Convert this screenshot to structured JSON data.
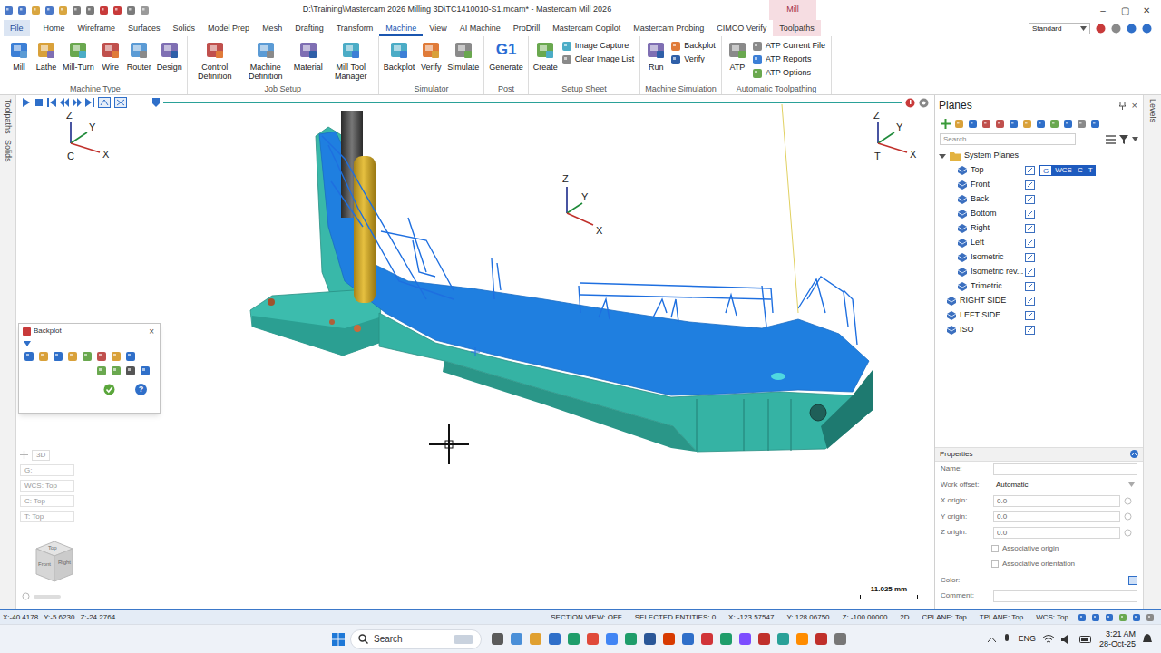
{
  "window": {
    "title": "D:\\Training\\Mastercam 2026 Milling 3D\\TC1410010-S1.mcam* - Mastercam Mill 2026",
    "context_label": "Mill",
    "controls": [
      "–",
      "▢",
      "✕"
    ]
  },
  "ribbon": {
    "tabs": [
      {
        "label": "File",
        "kind": "file",
        "selected": false
      },
      {
        "label": "Home",
        "kind": "tab",
        "selected": false
      },
      {
        "label": "Wireframe",
        "kind": "tab",
        "selected": false
      },
      {
        "label": "Surfaces",
        "kind": "tab",
        "selected": false
      },
      {
        "label": "Solids",
        "kind": "tab",
        "selected": false
      },
      {
        "label": "Model Prep",
        "kind": "tab",
        "selected": false
      },
      {
        "label": "Mesh",
        "kind": "tab",
        "selected": false
      },
      {
        "label": "Drafting",
        "kind": "tab",
        "selected": false
      },
      {
        "label": "Transform",
        "kind": "tab",
        "selected": false
      },
      {
        "label": "Machine",
        "kind": "tab",
        "selected": true
      },
      {
        "label": "View",
        "kind": "tab",
        "selected": false
      },
      {
        "label": "AI Machine",
        "kind": "tab",
        "selected": false
      },
      {
        "label": "ProDrill",
        "kind": "tab",
        "selected": false
      },
      {
        "label": "Mastercam Copilot",
        "kind": "tab",
        "selected": false
      },
      {
        "label": "Mastercam Probing",
        "kind": "tab",
        "selected": false
      },
      {
        "label": "CIMCO Verify",
        "kind": "tab",
        "selected": false
      },
      {
        "label": "Toolpaths",
        "kind": "context",
        "selected": false
      }
    ],
    "workspace": "Standard",
    "groups": [
      {
        "label": "Machine Type",
        "items": [
          {
            "label": "Mill",
            "kind": "large"
          },
          {
            "label": "Lathe",
            "kind": "large"
          },
          {
            "label": "Mill-Turn",
            "kind": "large"
          },
          {
            "label": "Wire",
            "kind": "large"
          },
          {
            "label": "Router",
            "kind": "large"
          },
          {
            "label": "Design",
            "kind": "large"
          }
        ]
      },
      {
        "label": "Job Setup",
        "items": [
          {
            "label": "Control Definition",
            "kind": "large"
          },
          {
            "label": "Machine Definition",
            "kind": "large"
          },
          {
            "label": "Material",
            "kind": "large"
          },
          {
            "label": "Mill Tool Manager",
            "kind": "large"
          }
        ]
      },
      {
        "label": "Simulator",
        "items": [
          {
            "label": "Backplot",
            "kind": "large"
          },
          {
            "label": "Verify",
            "kind": "large"
          },
          {
            "label": "Simulate",
            "kind": "large"
          }
        ]
      },
      {
        "label": "Post",
        "items": [
          {
            "label": "Generate",
            "kind": "large",
            "glyph": "G1"
          }
        ]
      },
      {
        "label": "Setup Sheet",
        "items": [
          {
            "label": "Create",
            "kind": "large"
          },
          {
            "label": "Image Capture",
            "kind": "small"
          },
          {
            "label": "Clear Image List",
            "kind": "small"
          }
        ]
      },
      {
        "label": "Machine Simulation",
        "items": [
          {
            "label": "Run",
            "kind": "large"
          },
          {
            "label": "Backplot",
            "kind": "small"
          },
          {
            "label": "Verify",
            "kind": "small"
          }
        ]
      },
      {
        "label": "Automatic Toolpathing",
        "items": [
          {
            "label": "ATP",
            "kind": "large"
          },
          {
            "label": "ATP Current File",
            "kind": "small"
          },
          {
            "label": "ATP Reports",
            "kind": "small"
          },
          {
            "label": "ATP Options",
            "kind": "small"
          }
        ]
      }
    ]
  },
  "playback": {
    "level": 1
  },
  "side_tabs": {
    "left": [
      "Toolpaths",
      "Solids"
    ],
    "right": [
      "Levels"
    ]
  },
  "viewport": {
    "gizmo_left": {
      "axes": {
        "z": "Z",
        "y": "Y",
        "x": "X"
      },
      "label": "C"
    },
    "gizmo_center": {
      "axes": {
        "z": "Z",
        "y": "Y",
        "x": "X"
      }
    },
    "gizmo_right": {
      "axes": {
        "z": "Z",
        "y": "Y",
        "x": "X"
      },
      "label": "T"
    },
    "scale": "11.025 mm"
  },
  "backplot": {
    "title": "Backplot",
    "close": "×",
    "help": "?"
  },
  "view_info": {
    "mode": "3D",
    "rows": [
      "G:",
      "WCS: Top",
      "C: Top",
      "T: Top"
    ],
    "cube_faces": [
      "Top",
      "Front",
      "Right"
    ]
  },
  "planes": {
    "title": "Planes",
    "close": "×",
    "search": {
      "placeholder": "Search"
    },
    "tree": [
      {
        "label": "System Planes",
        "kind": "folder",
        "expanded": true
      },
      {
        "label": "Top",
        "kind": "plane",
        "badges": [
          "G",
          "WCS",
          "C",
          "T"
        ]
      },
      {
        "label": "Front",
        "kind": "plane"
      },
      {
        "label": "Back",
        "kind": "plane"
      },
      {
        "label": "Bottom",
        "kind": "plane"
      },
      {
        "label": "Right",
        "kind": "plane"
      },
      {
        "label": "Left",
        "kind": "plane"
      },
      {
        "label": "Isometric",
        "kind": "plane"
      },
      {
        "label": "Isometric rev...",
        "kind": "plane"
      },
      {
        "label": "Trimetric",
        "kind": "plane"
      },
      {
        "label": "RIGHT SIDE",
        "kind": "user"
      },
      {
        "label": "LEFT SIDE",
        "kind": "user"
      },
      {
        "label": "ISO",
        "kind": "user"
      }
    ],
    "properties": {
      "title": "Properties",
      "fields": [
        {
          "label": "Name:",
          "kind": "text",
          "value": ""
        },
        {
          "label": "Work offset:",
          "kind": "select",
          "value": "Automatic"
        },
        {
          "label": "X origin:",
          "kind": "number",
          "value": "0.0"
        },
        {
          "label": "Y origin:",
          "kind": "number",
          "value": "0.0"
        },
        {
          "label": "Z origin:",
          "kind": "number",
          "value": "0.0"
        },
        {
          "label": "Associative origin",
          "kind": "checkbox",
          "checked": false
        },
        {
          "label": "Associative orientation",
          "kind": "checkbox",
          "checked": false
        },
        {
          "label": "Color:",
          "kind": "color"
        },
        {
          "label": "Comment:",
          "kind": "text",
          "value": ""
        }
      ]
    }
  },
  "status_bar": {
    "cursor": [
      "X:-40.4178",
      "Y:-5.6230",
      "Z:-24.2764"
    ],
    "items": [
      "SECTION VIEW: OFF",
      "SELECTED ENTITIES: 0",
      "X: -123.57547",
      "Y: 128.06750",
      "Z: -100.00000",
      "2D",
      "CPLANE: Top",
      "TPLANE: Top",
      "WCS: Top"
    ]
  },
  "taskbar": {
    "search": "Search",
    "language": "ENG",
    "time": "3:21 AM",
    "date": "28-Oct-25"
  }
}
